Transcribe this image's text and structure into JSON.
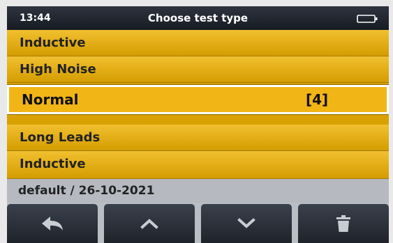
{
  "status_bar": {
    "time": "13:44",
    "title": "Choose test type"
  },
  "list": {
    "items": [
      {
        "label": "Inductive"
      },
      {
        "label": "High Noise"
      },
      {
        "label": "Normal",
        "count": "[4]",
        "selected": true
      },
      {
        "label": "Long Leads"
      },
      {
        "label": "Inductive"
      }
    ]
  },
  "footer": {
    "info": "default / 26-10-2021"
  },
  "softkeys": [
    {
      "icon": "back-arrow-icon"
    },
    {
      "icon": "chevron-up-icon"
    },
    {
      "icon": "chevron-down-icon"
    },
    {
      "icon": "trash-icon"
    }
  ],
  "colors": {
    "accent": "#f2b516",
    "item": "#e0a810",
    "statusbar": "#1f242c"
  }
}
